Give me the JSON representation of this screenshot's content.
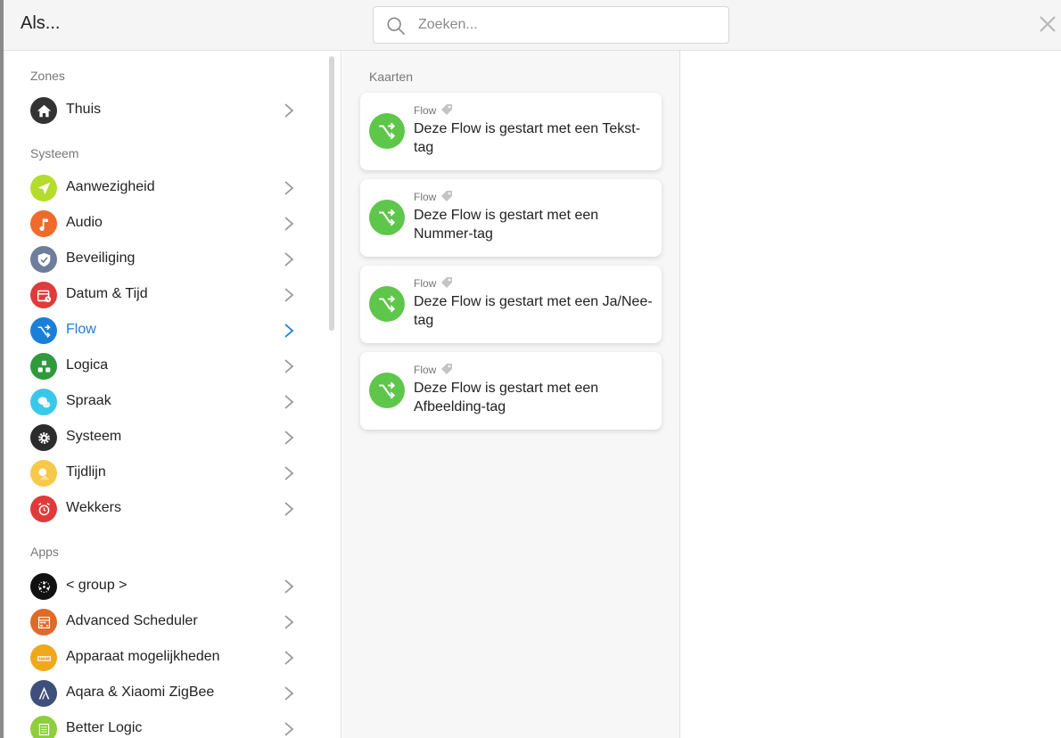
{
  "header": {
    "title": "Als...",
    "search_placeholder": "Zoeken..."
  },
  "sidebar": {
    "sections": [
      {
        "title": "Zones",
        "items": [
          {
            "label": "Thuis",
            "icon": "home-icon",
            "color": "#333333"
          }
        ]
      },
      {
        "title": "Systeem",
        "items": [
          {
            "label": "Aanwezigheid",
            "icon": "location-arrow-icon",
            "color": "#b4dc2c"
          },
          {
            "label": "Audio",
            "icon": "music-note-icon",
            "color": "#f06a2a"
          },
          {
            "label": "Beveiliging",
            "icon": "shield-icon",
            "color": "#6e7d9a"
          },
          {
            "label": "Datum & Tijd",
            "icon": "calendar-clock-icon",
            "color": "#e03a3a"
          },
          {
            "label": "Flow",
            "icon": "flow-shuffle-icon",
            "color": "#1a7fd9"
          },
          {
            "label": "Logica",
            "icon": "logic-blocks-icon",
            "color": "#2e9a3c"
          },
          {
            "label": "Spraak",
            "icon": "speech-bubbles-icon",
            "color": "#3bc8e8"
          },
          {
            "label": "Systeem",
            "icon": "gear-icon",
            "color": "#2c2c2c"
          },
          {
            "label": "Tijdlijn",
            "icon": "timeline-icon",
            "color": "#f7c84a"
          },
          {
            "label": "Wekkers",
            "icon": "alarm-clock-icon",
            "color": "#e03a3a"
          }
        ]
      },
      {
        "title": "Apps",
        "items": [
          {
            "label": "< group >",
            "icon": "group-dots-icon",
            "color": "#111111"
          },
          {
            "label": "Advanced Scheduler",
            "icon": "scheduler-icon",
            "color": "#e06a2a"
          },
          {
            "label": "Apparaat mogelijkheden",
            "icon": "ruler-icon",
            "color": "#f0a81a"
          },
          {
            "label": "Aqara & Xiaomi ZigBee",
            "icon": "aqara-icon",
            "color": "#3d4f7a"
          },
          {
            "label": "Better Logic",
            "icon": "better-logic-icon",
            "color": "#8ccf3a"
          }
        ]
      }
    ],
    "active_label": "Flow"
  },
  "main": {
    "title": "Kaarten",
    "cards": [
      {
        "category": "Flow",
        "text": "Deze Flow is gestart met een Tekst-tag"
      },
      {
        "category": "Flow",
        "text": "Deze Flow is gestart met een Nummer-tag"
      },
      {
        "category": "Flow",
        "text": "Deze Flow is gestart met een Ja/Nee-tag"
      },
      {
        "category": "Flow",
        "text": "Deze Flow is gestart met een Afbeelding-tag"
      }
    ],
    "card_icon_color": "#5ec64a"
  }
}
